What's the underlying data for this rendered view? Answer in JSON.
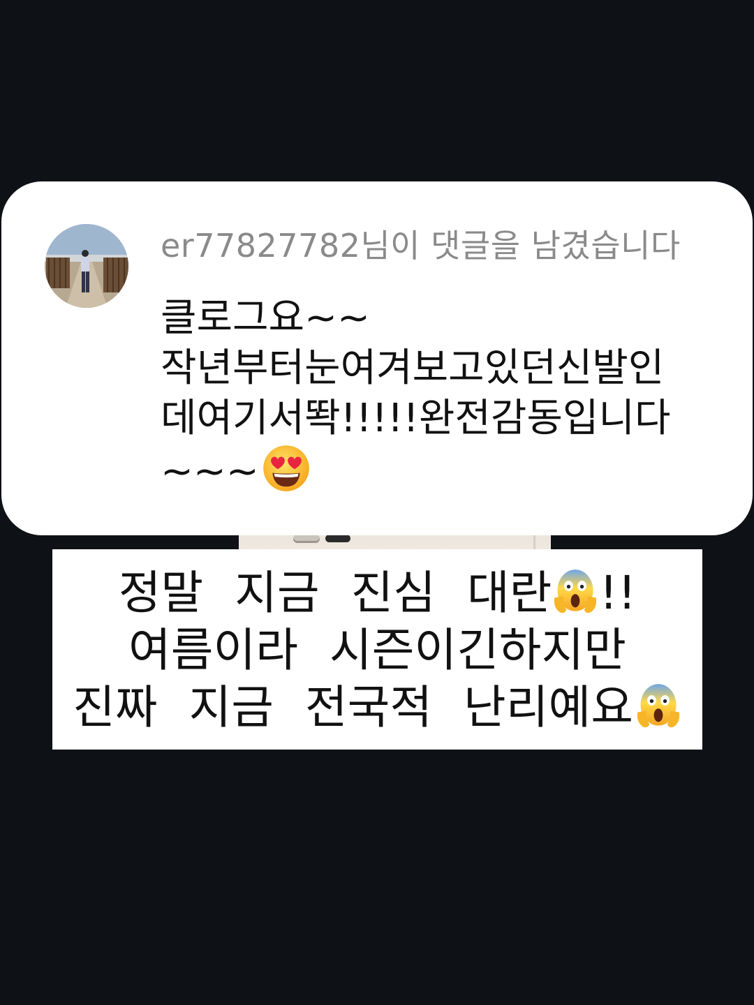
{
  "notification": {
    "username": "er77827782",
    "header": "er77827782님이 댓글을 남겼습니다",
    "comment_lines": [
      "클로그요~~",
      "작년부터눈여겨보고있던신발인",
      "데여기서똭!!!!!완전감동입니다",
      "~~~"
    ],
    "comment_end_emoji": "heart-eyes-emoji"
  },
  "caption": {
    "lines": [
      "정말 지금 진심 대란",
      "여름이라 시즌이긴하지만",
      "진짜 지금 전국적 난리예요"
    ],
    "line1_suffix": "!!",
    "emoji": "screaming-face-emoji"
  },
  "colors": {
    "background": "#0e1116",
    "card": "#ffffff",
    "header_text": "#8a8a8a",
    "body_text": "#111111"
  }
}
